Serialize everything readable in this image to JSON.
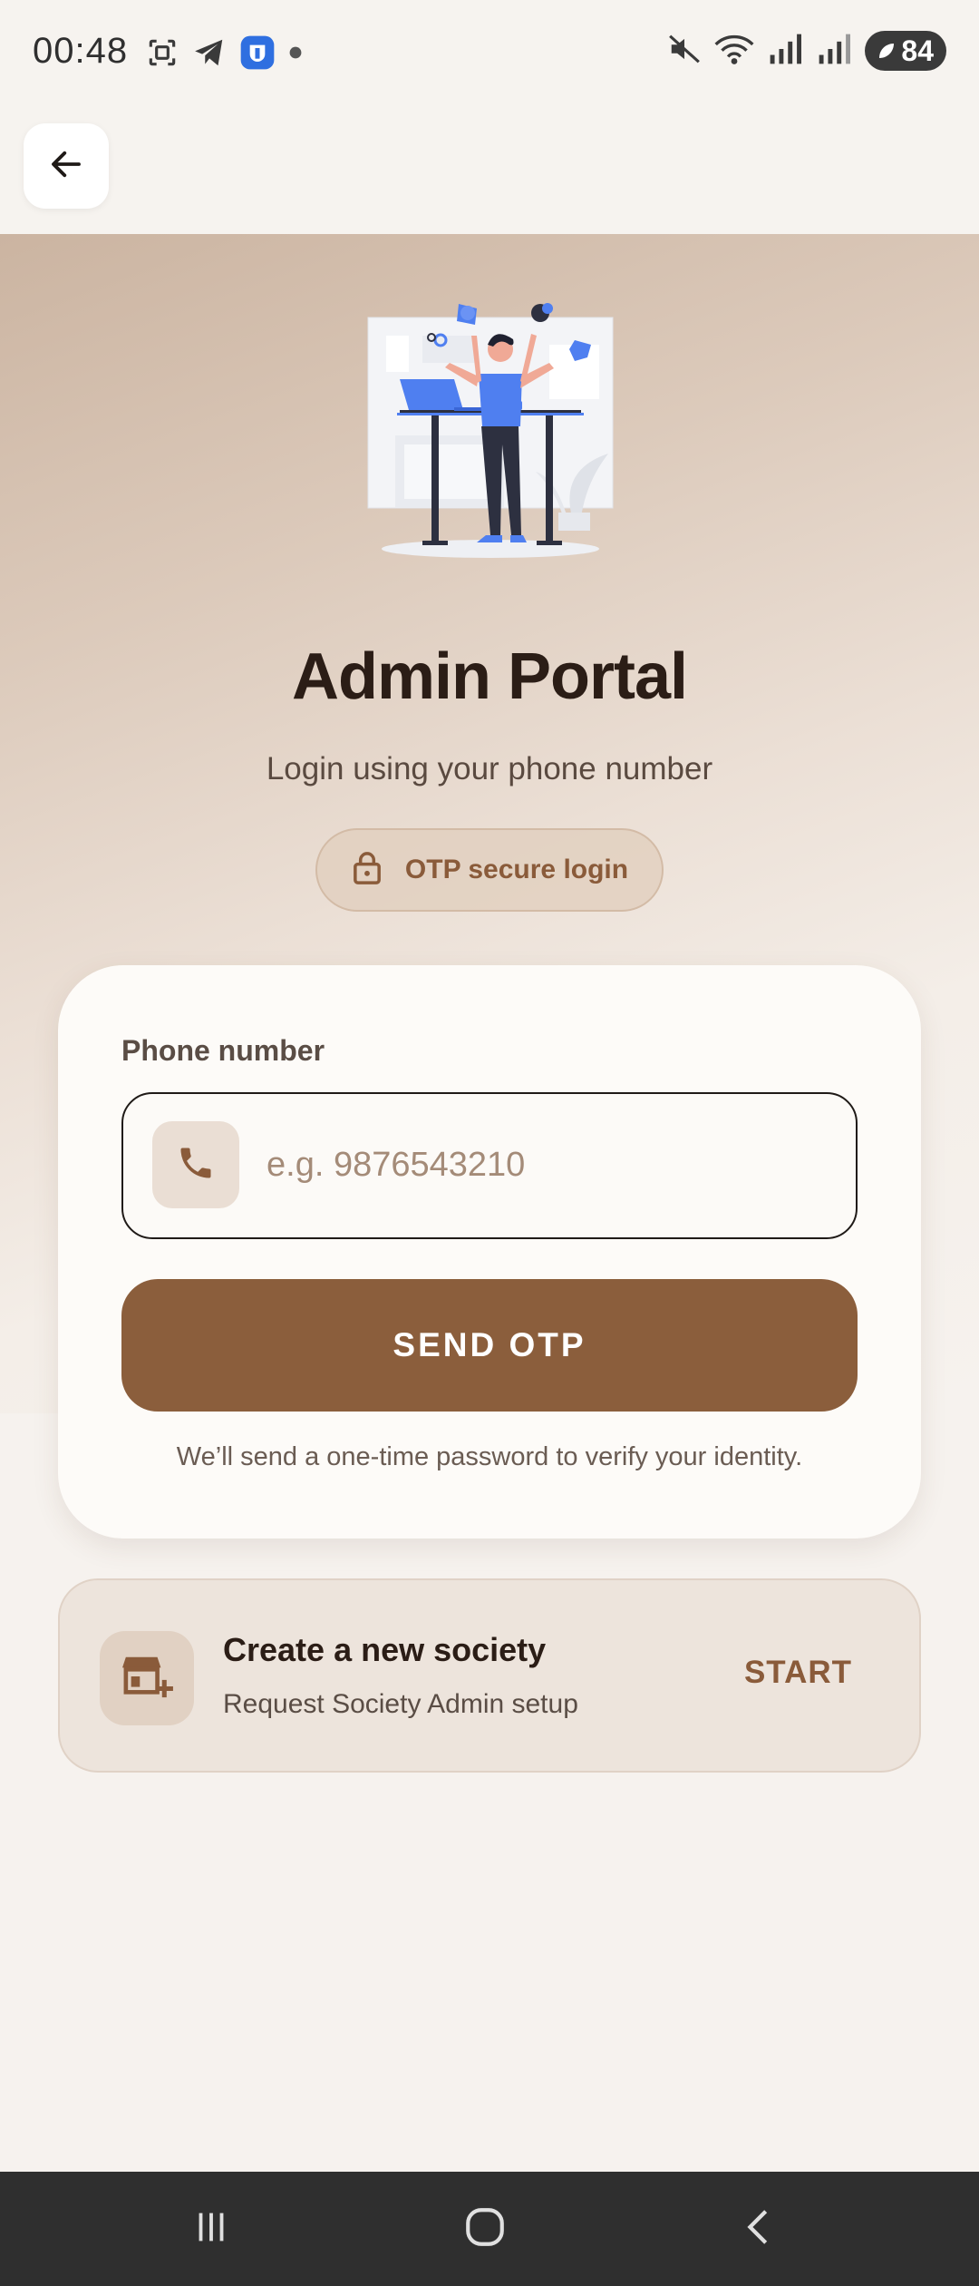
{
  "status_bar": {
    "time": "00:48",
    "battery": "84",
    "left_icons": [
      "screenshot-icon",
      "telegram-icon",
      "app-shield-icon",
      "dot-icon"
    ],
    "right_icons": [
      "mute-icon",
      "wifi-icon",
      "signal-icon",
      "signal-icon-2",
      "battery-icon"
    ]
  },
  "app_bar": {
    "back_icon": "arrow-left-icon"
  },
  "hero": {
    "title": "Admin Portal",
    "subtitle": "Login using your phone number",
    "badge_label": "OTP secure login",
    "badge_icon": "lock-icon"
  },
  "login_card": {
    "field_label": "Phone number",
    "phone_placeholder": "e.g. 9876543210",
    "phone_value": "",
    "phone_icon": "phone-icon",
    "send_button_label": "SEND OTP",
    "helper_text": "We’ll send a one-time password to verify your identity."
  },
  "society_card": {
    "icon": "store-add-icon",
    "title": "Create a new society",
    "subtitle": "Request Society Admin setup",
    "action_label": "START"
  },
  "nav_bar": {
    "buttons": [
      "recents-icon",
      "home-icon",
      "back-icon"
    ]
  },
  "colors": {
    "accent": "#8b5e3c",
    "accent_text": "#8a5b3a",
    "title": "#2b1d16",
    "background": "#f6f2ee"
  }
}
